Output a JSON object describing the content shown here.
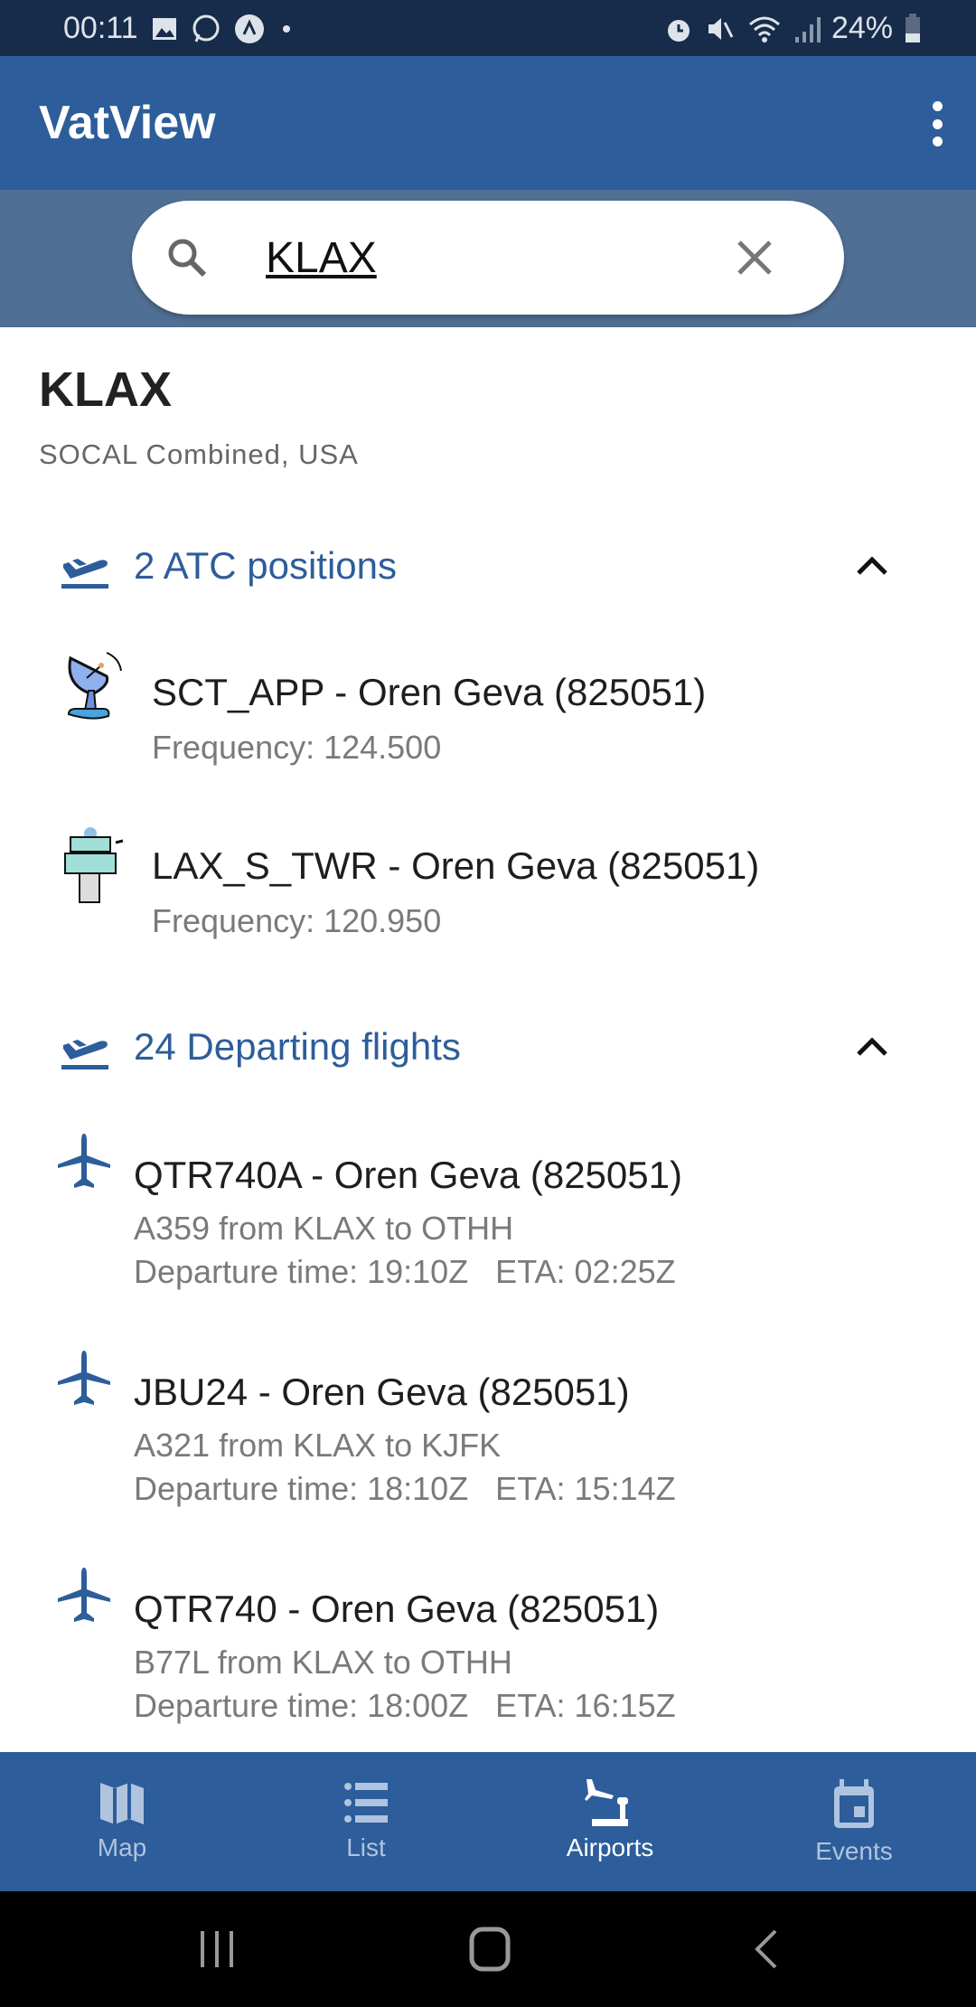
{
  "status_bar": {
    "time": "00:11",
    "battery": "24%"
  },
  "app_bar": {
    "title": "VatView",
    "menu_icon": "more-vert-icon"
  },
  "search": {
    "value": "KLAX",
    "placeholder": "",
    "search_icon": "search-icon",
    "clear_icon": "close-icon"
  },
  "airport": {
    "code": "KLAX",
    "subtitle": "SOCAL Combined, USA"
  },
  "atc_section": {
    "label": "2 ATC positions",
    "icon": "flight-takeoff-icon",
    "expanded": true,
    "items": [
      {
        "title": "SCT_APP - Oren Geva (825051)",
        "frequency": "Frequency: 124.500",
        "icon": "radar-dish-icon"
      },
      {
        "title": "LAX_S_TWR - Oren Geva (825051)",
        "frequency": "Frequency: 120.950",
        "icon": "control-tower-icon"
      }
    ]
  },
  "departures_section": {
    "label": "24 Departing flights",
    "icon": "flight-takeoff-icon",
    "expanded": true,
    "items": [
      {
        "title": "QTR740A - Oren Geva (825051)",
        "route": "A359 from KLAX to OTHH",
        "times": "Departure time: 19:10Z   ETA: 02:25Z"
      },
      {
        "title": "JBU24 - Oren Geva (825051)",
        "route": "A321 from KLAX to KJFK",
        "times": "Departure time: 18:10Z   ETA: 15:14Z"
      },
      {
        "title": "QTR740 - Oren Geva (825051)",
        "route": "B77L from KLAX to OTHH",
        "times": "Departure time: 18:00Z   ETA: 16:15Z"
      }
    ]
  },
  "bottom_nav": {
    "active": "Airports",
    "tabs": [
      {
        "label": "Map"
      },
      {
        "label": "List"
      },
      {
        "label": "Airports"
      },
      {
        "label": "Events"
      }
    ]
  },
  "colors": {
    "primary": "#2d5d9a",
    "status_bar": "#172b4a",
    "search_band": "#4f6f94"
  }
}
